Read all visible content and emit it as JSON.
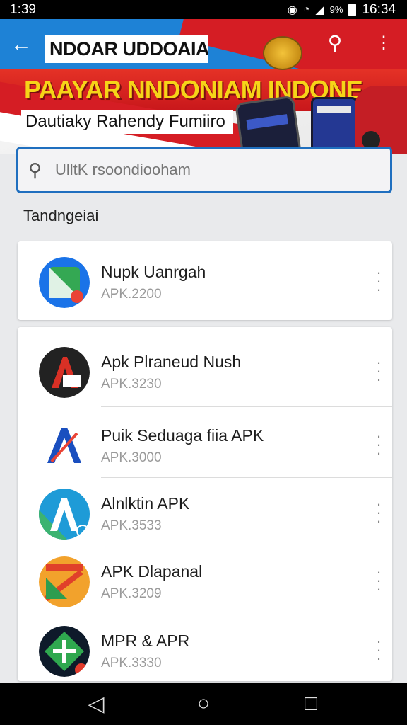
{
  "status": {
    "time": "1:39",
    "battery": "9%",
    "clock": "16:34"
  },
  "banner": {
    "title": "NDOAR UDDOAIAI",
    "headline": "PAAYAR NNDONIAM INDONESIA!",
    "subtitle": "Dautiaky Rahendy Fumiiro"
  },
  "search": {
    "placeholder": "UlltK rsoondiooham"
  },
  "section": {
    "title": "Tandngeiai"
  },
  "apps": [
    {
      "name": "Nupk Uanrgah",
      "meta": "APK.2200",
      "icon": "maps-app-icon",
      "colors": [
        "#1a73e8",
        "#34a853",
        "#ea4335"
      ]
    },
    {
      "name": "Apk Plraneud Nush",
      "meta": "APK.3230",
      "icon": "red-a-app-icon",
      "colors": [
        "#222222",
        "#d93025",
        "#ffffff"
      ]
    },
    {
      "name": "Puik Seduaga fiia APK",
      "meta": "APK.3000",
      "icon": "blue-a-app-icon",
      "colors": [
        "#ffffff",
        "#1a4fbf",
        "#ea4335"
      ]
    },
    {
      "name": "Alnlktin APK",
      "meta": "APK.3533",
      "icon": "green-a-app-icon",
      "colors": [
        "#1e9bd7",
        "#3cb371",
        "#ffffff"
      ]
    },
    {
      "name": "APK Dlapanal",
      "meta": "APK.3209",
      "icon": "orange-app-icon",
      "colors": [
        "#f2a22c",
        "#e0402a",
        "#2e9d4f"
      ]
    },
    {
      "name": "MPR & APR",
      "meta": "APK.3330",
      "icon": "diamond-app-icon",
      "colors": [
        "#0e1a2a",
        "#2fa84f",
        "#e23b2c"
      ]
    }
  ],
  "nav": {
    "back": "◁",
    "home": "○",
    "recents": "□"
  }
}
